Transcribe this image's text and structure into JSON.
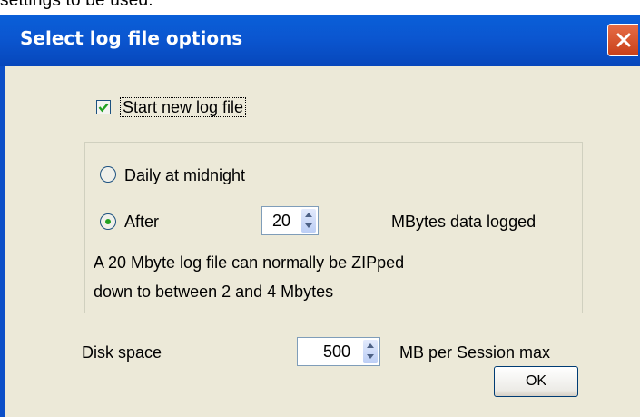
{
  "background_text": "settings to be used.",
  "dialog": {
    "title": "Select log file options",
    "close_icon": "close-x-icon",
    "start_new_log": {
      "label": "Start new log file",
      "checked": true
    },
    "rollover": {
      "daily": {
        "label": "Daily at midnight",
        "selected": false
      },
      "after": {
        "label": "After",
        "selected": true,
        "value": "20",
        "unit_label": "MBytes data logged"
      },
      "note_line1": "A 20 Mbyte log file can normally be ZIPped",
      "note_line2": "down to between 2 and 4 Mbytes"
    },
    "disk_space": {
      "label": "Disk space",
      "value": "500",
      "unit_label": "MB per Session max"
    },
    "ok_label": "OK"
  },
  "colors": {
    "title_bar": "#0b56d0",
    "close_button": "#d4522a",
    "dialog_face": "#ece9d8",
    "checkmark": "#21a121"
  }
}
